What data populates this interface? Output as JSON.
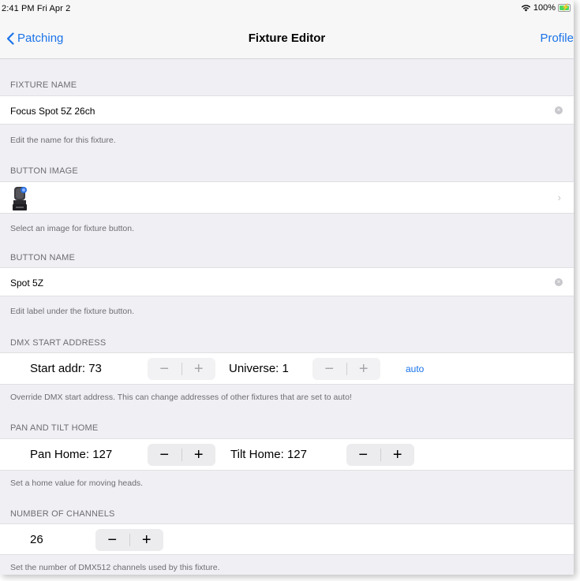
{
  "status": {
    "time": "2:41 PM  Fri Apr 2",
    "battery": "100%"
  },
  "nav": {
    "back_label": "Patching",
    "title": "Fixture Editor",
    "profile_label": "Profile"
  },
  "fixture_name": {
    "header": "FIXTURE NAME",
    "value": "Focus Spot 5Z 26ch",
    "footer": "Edit the name for this fixture."
  },
  "button_image": {
    "header": "BUTTON IMAGE",
    "footer": "Select an image for fixture button."
  },
  "button_name": {
    "header": "BUTTON NAME",
    "value": "Spot 5Z",
    "footer": "Edit label under the fixture button."
  },
  "dmx": {
    "header": "DMX START ADDRESS",
    "start_label": "Start addr: 73",
    "universe_label": "Universe: 1",
    "auto_label": "auto",
    "footer": "Override DMX start address. This can change addresses of other fixtures that are set to auto!"
  },
  "pan_tilt": {
    "header": "PAN AND TILT HOME",
    "pan_label": "Pan Home: 127",
    "tilt_label": "Tilt Home: 127",
    "footer": "Set a home value for moving heads."
  },
  "channels": {
    "header": "NUMBER OF CHANNELS",
    "value": "26",
    "footer": "Set the number of DMX512 channels used by this fixture."
  },
  "stepper": {
    "minus": "−",
    "plus": "+"
  },
  "colors": {
    "accent": "#1a73e8",
    "background": "#efeff4",
    "battery": "#4cd964"
  },
  "icons": {
    "back": "chevron-left-icon",
    "clear": "clear-x-icon",
    "disclosure": "chevron-right-icon",
    "wifi": "wifi-icon",
    "battery": "battery-charging-icon"
  }
}
